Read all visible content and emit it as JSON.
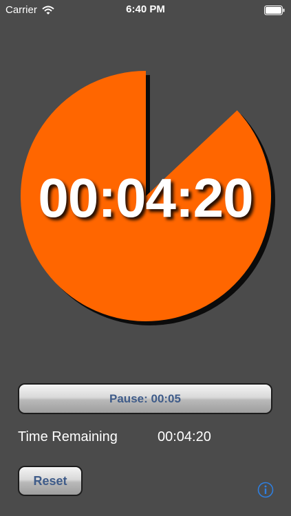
{
  "status_bar": {
    "carrier": "Carrier",
    "time": "6:40 PM"
  },
  "timer": {
    "display": "00:04:20",
    "remaining_fraction": 0.87,
    "pie_color": "#ff6600"
  },
  "controls": {
    "pause_label": "Pause: 00:05",
    "time_remaining_label": "Time Remaining",
    "time_remaining_value": "00:04:20",
    "reset_label": "Reset"
  },
  "icons": {
    "info": "info-icon",
    "wifi": "wifi-icon",
    "battery": "battery-icon"
  }
}
